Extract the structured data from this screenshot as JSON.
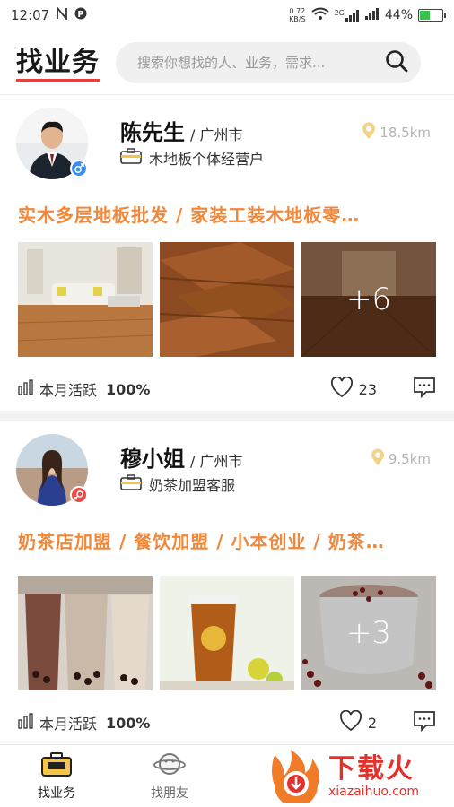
{
  "status_bar": {
    "time": "12:07",
    "net_speed_value": "0.72",
    "net_speed_unit": "KB/S",
    "signal_label": "2G",
    "battery": "44%",
    "battery_level": 0.44,
    "battery_color": "#34c44a"
  },
  "header": {
    "logo": "找业务",
    "search_placeholder": "搜索你想找的人、业务，需求..."
  },
  "cards": [
    {
      "name": "陈先生",
      "city": "/ 广州市",
      "distance": "18.5km",
      "job": "木地板个体经营户",
      "tags": "实木多层地板批发 /  家装工装木地板零…",
      "more_photos": "+6",
      "activity": "本月活跃",
      "activity_percent": "100%",
      "likes": "23",
      "gender": "male"
    },
    {
      "name": "穆小姐",
      "city": "/ 广州市",
      "distance": "9.5km",
      "job": "奶茶加盟客服",
      "tags": "奶茶店加盟 / 餐饮加盟 / 小本创业 / 奶茶…",
      "more_photos": "+3",
      "activity": "本月活跃",
      "activity_percent": "100%",
      "likes": "2",
      "gender": "female"
    }
  ],
  "bottom_nav": {
    "tab1": "找业务",
    "tab2": "找朋友"
  },
  "watermark": {
    "cn": "下载火",
    "en": "xiazaihuo.com"
  },
  "colors": {
    "accent_orange": "#f0883c",
    "logo_underline": "#e8413a",
    "watermark_red": "#e3322b"
  }
}
